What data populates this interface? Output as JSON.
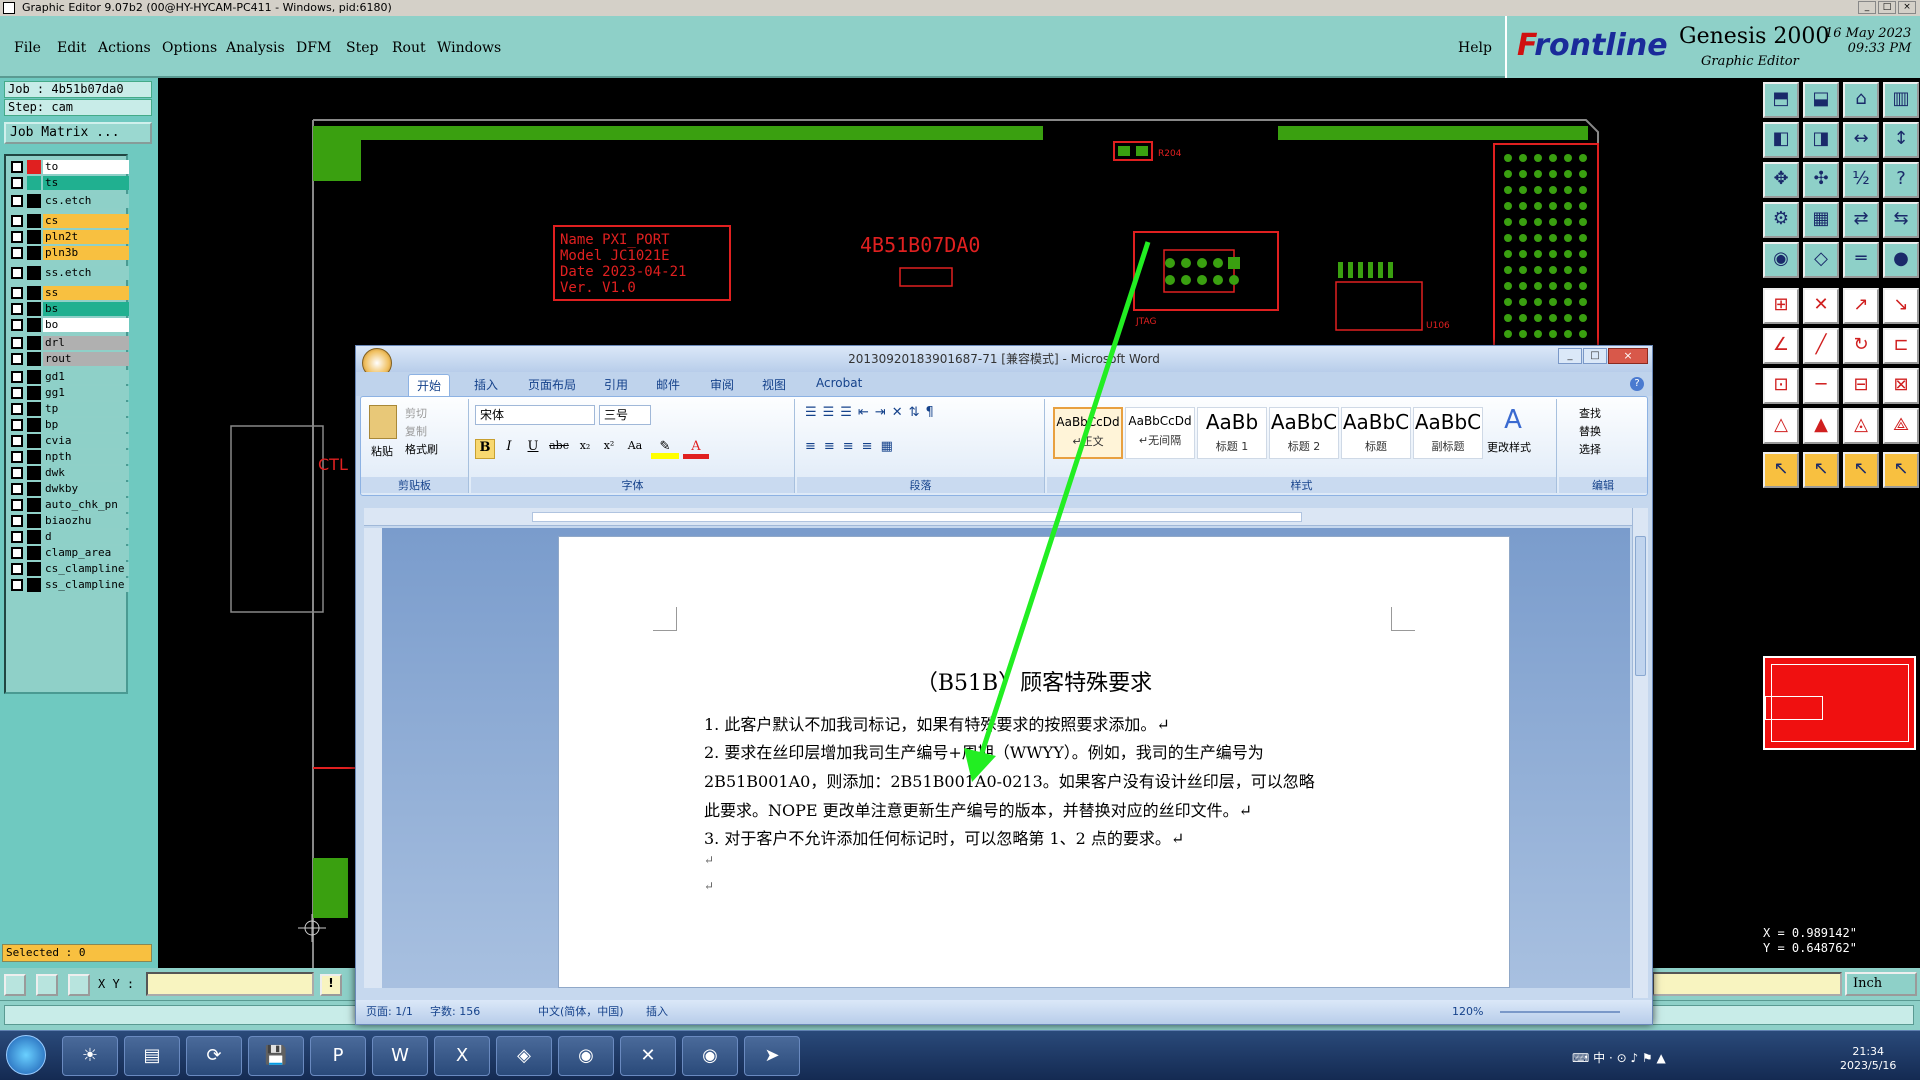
{
  "window": {
    "title": "Graphic Editor 9.07b2 (00@HY-HYCAM-PC411 - Windows, pid:6180)"
  },
  "menu": [
    "File",
    "Edit",
    "Actions",
    "Options",
    "Analysis",
    "DFM",
    "Step",
    "Rout",
    "Windows"
  ],
  "help": "Help",
  "brand": {
    "logo_prefix": "F",
    "logo_rest": "rontline",
    "product": "Genesis 2000",
    "subtitle": "Graphic Editor",
    "date": "16 May 2023",
    "time": "09:33 PM"
  },
  "job": {
    "job": "Job : 4b51b07da0",
    "step": "Step: cam",
    "matrix": "Job Matrix ..."
  },
  "layers": [
    {
      "name": "to",
      "color": "#ffffff",
      "mark": "#e02020"
    },
    {
      "name": "ts",
      "color": "#20b090",
      "mark": "#20b090"
    },
    {
      "name": "cs.etch",
      "color": "#8ed0c8",
      "mark": ""
    },
    {
      "name": "cs",
      "color": "#f8c040",
      "mark": ""
    },
    {
      "name": "pln2t",
      "color": "#f8c040",
      "mark": ""
    },
    {
      "name": "pln3b",
      "color": "#f8c040",
      "mark": ""
    },
    {
      "name": "ss.etch",
      "color": "#8ed0c8",
      "mark": ""
    },
    {
      "name": "ss",
      "color": "#f8c040",
      "mark": ""
    },
    {
      "name": "bs",
      "color": "#20b090",
      "mark": ""
    },
    {
      "name": "bo",
      "color": "#ffffff",
      "mark": ""
    },
    {
      "name": "drl",
      "color": "#b0b0b0",
      "mark": ""
    },
    {
      "name": "rout",
      "color": "#b0b0b0",
      "mark": ""
    },
    {
      "name": "gd1",
      "color": "#8ed0c8",
      "mark": ""
    },
    {
      "name": "gg1",
      "color": "#8ed0c8",
      "mark": ""
    },
    {
      "name": "tp",
      "color": "#8ed0c8",
      "mark": ""
    },
    {
      "name": "bp",
      "color": "#8ed0c8",
      "mark": ""
    },
    {
      "name": "cvia",
      "color": "#8ed0c8",
      "mark": ""
    },
    {
      "name": "npth",
      "color": "#8ed0c8",
      "mark": ""
    },
    {
      "name": "dwk",
      "color": "#8ed0c8",
      "mark": ""
    },
    {
      "name": "dwkby",
      "color": "#8ed0c8",
      "mark": ""
    },
    {
      "name": "auto_chk_pn",
      "color": "#8ed0c8",
      "mark": ""
    },
    {
      "name": "biaozhu",
      "color": "#8ed0c8",
      "mark": ""
    },
    {
      "name": "d",
      "color": "#8ed0c8",
      "mark": ""
    },
    {
      "name": "clamp_area",
      "color": "#8ed0c8",
      "mark": ""
    },
    {
      "name": "cs_clampline",
      "color": "#8ed0c8",
      "mark": ""
    },
    {
      "name": "ss_clampline",
      "color": "#8ed0c8",
      "mark": ""
    }
  ],
  "selected": "Selected : 0",
  "xy_label": "X Y :",
  "coords": {
    "x": "X = 0.989142\"",
    "y": "Y = 0.648762\""
  },
  "units": "Inch",
  "pcb": {
    "name_block": [
      "Name PXI_PORT",
      "Model JC1021E",
      "Date 2023-04-21",
      "Ver. V1.0"
    ],
    "job_text": "4B51B07DA0",
    "r204": "R204",
    "jtag": "JTAG",
    "u106": "U106",
    "ctl": "CTL"
  },
  "word": {
    "title": "20130920183901687-71 [兼容模式] - Microsoft Word",
    "tabs": [
      "开始",
      "插入",
      "页面布局",
      "引用",
      "邮件",
      "审阅",
      "视图",
      "Acrobat"
    ],
    "clipboard": {
      "paste": "粘贴",
      "cut": "剪切",
      "copy": "复制",
      "painter": "格式刷",
      "label": "剪贴板"
    },
    "font": {
      "name": "宋体",
      "size": "三号",
      "label": "字体"
    },
    "paragraph_label": "段落",
    "styles": [
      {
        "sample": "AaBbCcDd",
        "name": "↵正文"
      },
      {
        "sample": "AaBbCcDd",
        "name": "↵无间隔"
      },
      {
        "sample": "AaBb",
        "name": "标题 1"
      },
      {
        "sample": "AaBbC",
        "name": "标题 2"
      },
      {
        "sample": "AaBbC",
        "name": "标题"
      },
      {
        "sample": "AaBbC",
        "name": "副标题"
      }
    ],
    "styles_label": "样式",
    "change_style": "更改样式",
    "edit": {
      "find": "查找",
      "replace": "替换",
      "select": "选择",
      "label": "编辑"
    },
    "doc_title": "（B51B）顾客特殊要求",
    "lines": [
      "1. 此客户默认不加我司标记，如果有特殊要求的按照要求添加。↵",
      "2. 要求在丝印层增加我司生产编号+周期（WWYY）。例如，我司的生产编号为",
      "2B51B001A0，则添加：2B51B001A0-0213。如果客户没有设计丝印层，可以忽略",
      "此要求。NOPE 更改单注意更新生产编号的版本，并替换对应的丝印文件。↵",
      "3. 对于客户不允许添加任何标记时，可以忽略第 1、2 点的要求。↵",
      "↵",
      "↵"
    ],
    "status": {
      "page": "页面: 1/1",
      "words": "字数: 156",
      "lang": "中文(简体，中国)",
      "mode": "插入",
      "zoom": "120%"
    }
  },
  "tray": {
    "time": "21:34",
    "date": "2023/5/16"
  }
}
